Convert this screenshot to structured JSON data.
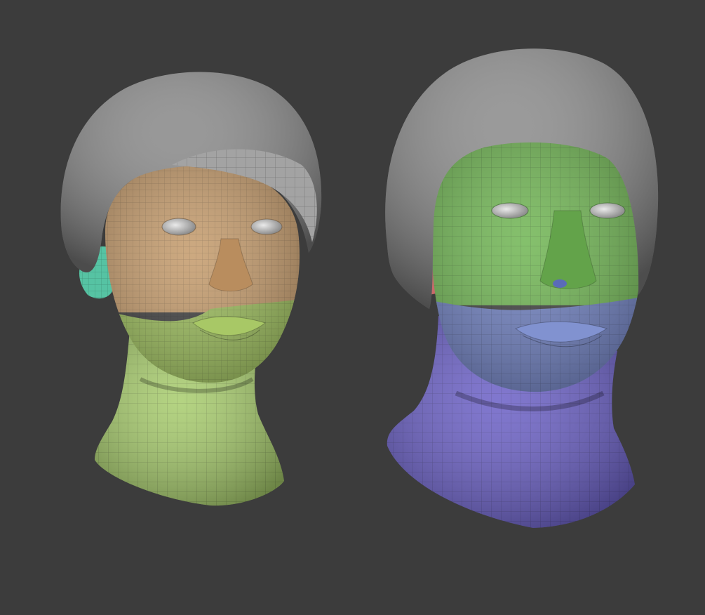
{
  "scene": {
    "background": "#3c3c3c",
    "description_free": true
  },
  "models": [
    {
      "id": "head-left",
      "polygroups": {
        "cap": "#8a8a8a",
        "cap_brim": "#a3a3a3",
        "face_upper": "#c49a6a",
        "face_lower": "#9bbd5a",
        "neck": "#a7cc6c",
        "ear": "#56c3a3",
        "eyes": "#c8c8c8"
      }
    },
    {
      "id": "head-right",
      "polygroups": {
        "cap": "#8c8c8c",
        "face_upper": "#6fb552",
        "face_lower": "#6e7fc0",
        "neck": "#6a5fc6",
        "ear": "#c86a6a",
        "eyes": "#c8c8c8"
      }
    }
  ]
}
